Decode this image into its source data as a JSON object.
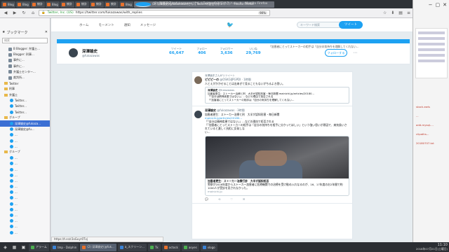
{
  "window": {
    "title": "(2) 深澤諭史(@fukazawas)さん | Twitterの返信付きツイート - Mozilla Firefox",
    "controls": [
      "－",
      "□",
      "✕"
    ]
  },
  "tabs": [
    {
      "label": "Blog",
      "icon": "blogger-icon"
    },
    {
      "label": "Blog",
      "icon": "blogger-icon"
    },
    {
      "label": "統計",
      "icon": "blogger-icon"
    },
    {
      "label": "Blog",
      "icon": "blogger-icon"
    },
    {
      "label": "統計",
      "icon": "blogger-icon"
    },
    {
      "label": "統計",
      "icon": "blogger-icon"
    },
    {
      "label": "統計",
      "icon": "blogger-icon"
    },
    {
      "label": "統計",
      "icon": "blogger-icon"
    },
    {
      "label": "Blog",
      "icon": "blogger-icon"
    },
    {
      "label": "(2) 深澤諭史(@fukazawas)さん | Twitterの返信付きツイート - Mozilla Firefox",
      "icon": "twitter-icon",
      "active": true
    }
  ],
  "nav": {
    "site_identity": "Twitter, Inc. (US)",
    "url": "https://twitter.com/fukazawas/with_replies",
    "zoom": "90%"
  },
  "sidebar": {
    "title": "ブックマーク",
    "search_placeholder": "検索",
    "items": [
      {
        "label": "B Blogger: 弁護士...",
        "type": "g"
      },
      {
        "label": "Blogger: 刑事...",
        "type": "g"
      },
      {
        "label": "事件に...",
        "type": "g"
      },
      {
        "label": "事件に...",
        "type": "g"
      },
      {
        "label": "弁護士センター...",
        "type": "g"
      },
      {
        "label": "裁判所...",
        "type": "g"
      },
      {
        "label": "Twitter",
        "type": "f"
      },
      {
        "label": "刑事",
        "type": "f"
      },
      {
        "label": "弁護士",
        "type": "f"
      },
      {
        "label": "Twitter...",
        "type": "t"
      },
      {
        "label": "Twitter...",
        "type": "t"
      },
      {
        "label": "Twitter...",
        "type": "t"
      },
      {
        "label": "グループ",
        "type": "f"
      },
      {
        "label": "深澤諭史@fukaza...",
        "type": "t",
        "selected": true
      },
      {
        "label": "深澤諭史@fu...",
        "type": "t"
      },
      {
        "label": "...",
        "type": "t"
      },
      {
        "label": "...",
        "type": "t"
      },
      {
        "label": "...",
        "type": "t"
      },
      {
        "label": "グループ",
        "type": "f"
      },
      {
        "label": "...",
        "type": "t"
      },
      {
        "label": "...",
        "type": "t"
      },
      {
        "label": "...",
        "type": "t"
      },
      {
        "label": "...",
        "type": "t"
      },
      {
        "label": "...",
        "type": "t"
      },
      {
        "label": "...",
        "type": "t"
      },
      {
        "label": "...",
        "type": "t"
      },
      {
        "label": "...",
        "type": "t"
      },
      {
        "label": "...",
        "type": "t"
      },
      {
        "label": "...",
        "type": "t"
      },
      {
        "label": "...",
        "type": "t"
      },
      {
        "label": "...",
        "type": "t"
      },
      {
        "label": "...",
        "type": "t"
      },
      {
        "label": "...",
        "type": "t"
      }
    ]
  },
  "twitter": {
    "nav": [
      "ホーム",
      "モーメント",
      "通知",
      "メッセージ"
    ],
    "search_placeholder": "キーワード検索",
    "tweet_button": "ツイート",
    "profile": {
      "name": "深澤諭史",
      "handle": "@fukazawas",
      "stats": [
        {
          "label": "ツイート",
          "value": "66,647"
        },
        {
          "label": "フォロー",
          "value": "406"
        },
        {
          "label": "フォロワー",
          "value": "3,636"
        },
        {
          "label": "いいね",
          "value": "29,769"
        }
      ],
      "follow_button": "フォローする",
      "more": "⋯"
    },
    "top_quote": "「加害者にとってストーカーの相手は「自分の気持ちを理解してくれない…",
    "tweets": [
      {
        "context": "深澤諭史さんがリツイート",
        "name": "ピピピーの",
        "handle": "@OSKGIJPGPDI",
        "time": "1時間",
        "text": "人とえがかかせることは出来ぎて見ることもないがちるよき思い。",
        "quote": {
          "name": "深澤諭史",
          "handle": "@fukazawas",
          "lines": [
            "加害者更生：ストーカー治療と刑　大半が認知形害・毎日新聞 mainichi.jp/articles/20180…",
            "「「自分は精神疾患ではない」」…などの理由で拒否される",
            "「「加害者にとってストーカーの相手は「自分の気持ちを理解してくれない…"
          ]
        }
      },
      {
        "context": "",
        "name": "深澤諭史",
        "handle": "@fukazawas",
        "time": "3時間",
        "text_lines": [
          "加害者更生：ストーカー治療と刑　大半が認知形害・毎日新聞",
          "mainichi.jp/articles/20180…",
          "「「自分は精神疾患ではない」」…などの理由で拒否される",
          "「「加害者にとってストーカーの相手は「自分の気持ちを相手に分かってほしい」という強い思いが原因で、病気扱いされていると激しく抗拒に反発しな",
          "い…"
        ],
        "card": {
          "title": "加害者更生：ストーカー治療打診　大半が認知拒否",
          "desc": "警察が2016年度からストーカー加害者に医療機関での治療を受け勧め入れなるのが、16、17年度のお2年間で約1000人が受診を見されなかった。",
          "domain": "mainichi.jp"
        },
        "actions": [
          "💬",
          "⟲",
          "♡",
          "✉"
        ]
      }
    ]
  },
  "statusbar": "https://t.co/r2oGuyr0Tvj",
  "rightpanel": {
    "lines": [
      "stock-ewls",
      "...",
      "add-mysql-...",
      "clipaths...",
      "20180707.txt"
    ]
  },
  "taskbar": {
    "items": [
      {
        "label": "アラーム",
        "dot": "g"
      },
      {
        "label": "tmp - Dolphin",
        "dot": "b"
      },
      {
        "label": "(2) 深澤諭史(@fuk...",
        "dot": "o",
        "active": true
      },
      {
        "label": "a_スクリーン...",
        "dot": "b"
      },
      {
        "label": "Tk",
        "dot": "g"
      },
      {
        "label": "octock",
        "dot": "o"
      },
      {
        "label": "aoyes",
        "dot": "g"
      },
      {
        "label": "xlogo",
        "dot": "b"
      }
    ],
    "time": "11:10",
    "date": "2018年07月21日(土曜日)"
  }
}
